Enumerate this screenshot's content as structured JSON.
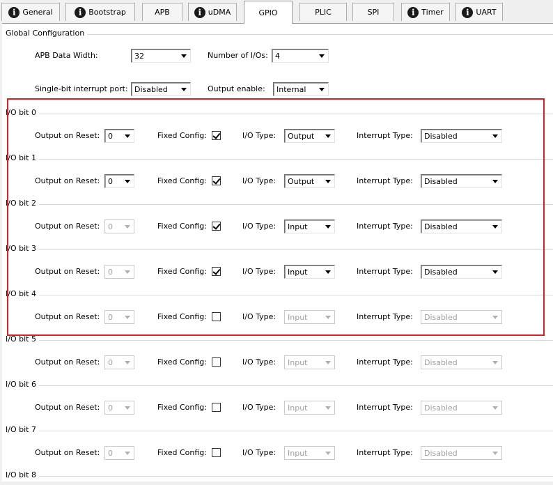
{
  "tabs": [
    {
      "label": "General",
      "icon": "info-icon",
      "active": false
    },
    {
      "label": "Bootstrap",
      "icon": "info-icon",
      "active": false
    },
    {
      "label": "APB",
      "icon": null,
      "active": false
    },
    {
      "label": "uDMA",
      "icon": "info-icon",
      "active": false
    },
    {
      "label": "GPIO",
      "icon": null,
      "active": true
    },
    {
      "label": "PLIC",
      "icon": null,
      "active": false
    },
    {
      "label": "SPI",
      "icon": null,
      "active": false
    },
    {
      "label": "Timer",
      "icon": "info-icon",
      "active": false
    },
    {
      "label": "UART",
      "icon": "info-icon",
      "active": false
    }
  ],
  "global": {
    "title": "Global Configuration",
    "apb_width_label": "APB Data Width:",
    "apb_width_value": "32",
    "num_ios_label": "Number of I/Os:",
    "num_ios_value": "4",
    "interrupt_port_label": "Single-bit interrupt port:",
    "interrupt_port_value": "Disabled",
    "output_enable_label": "Output enable:",
    "output_enable_value": "Internal"
  },
  "labels": {
    "output_on_reset": "Output on Reset:",
    "fixed_config": "Fixed Config:",
    "io_type": "I/O Type:",
    "interrupt_type": "Interrupt Type:"
  },
  "io_bits": [
    {
      "title": "I/O bit 0",
      "reset": "0",
      "fixed": true,
      "io_type": "Output",
      "interrupt": "Disabled",
      "reset_enabled": true,
      "type_enabled": true
    },
    {
      "title": "I/O bit 1",
      "reset": "0",
      "fixed": true,
      "io_type": "Output",
      "interrupt": "Disabled",
      "reset_enabled": true,
      "type_enabled": true
    },
    {
      "title": "I/O bit 2",
      "reset": "0",
      "fixed": true,
      "io_type": "Input",
      "interrupt": "Disabled",
      "reset_enabled": false,
      "type_enabled": true
    },
    {
      "title": "I/O bit 3",
      "reset": "0",
      "fixed": true,
      "io_type": "Input",
      "interrupt": "Disabled",
      "reset_enabled": false,
      "type_enabled": true
    },
    {
      "title": "I/O bit 4",
      "reset": "0",
      "fixed": false,
      "io_type": "Input",
      "interrupt": "Disabled",
      "reset_enabled": false,
      "type_enabled": false
    },
    {
      "title": "I/O bit 5",
      "reset": "0",
      "fixed": false,
      "io_type": "Input",
      "interrupt": "Disabled",
      "reset_enabled": false,
      "type_enabled": false
    },
    {
      "title": "I/O bit 6",
      "reset": "0",
      "fixed": false,
      "io_type": "Input",
      "interrupt": "Disabled",
      "reset_enabled": false,
      "type_enabled": false
    },
    {
      "title": "I/O bit 7",
      "reset": "0",
      "fixed": false,
      "io_type": "Input",
      "interrupt": "Disabled",
      "reset_enabled": false,
      "type_enabled": false
    },
    {
      "title": "I/O bit 8"
    }
  ],
  "colors": {
    "highlight_border": "#e02020"
  }
}
